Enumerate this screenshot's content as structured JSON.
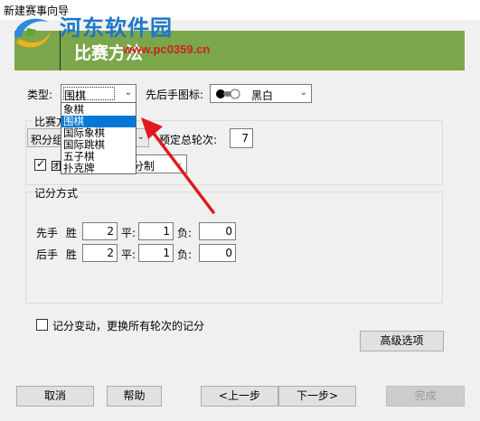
{
  "window": {
    "title": "新建赛事向导"
  },
  "watermark": {
    "name": "河东软件园",
    "url": "www.pc0359.cn"
  },
  "header": {
    "title": "比赛方法"
  },
  "type": {
    "label": "类型:",
    "value": "围棋",
    "options": [
      "象棋",
      "围棋",
      "国际象棋",
      "国际跳棋",
      "五子棋",
      "扑克牌"
    ],
    "selected_index": 1
  },
  "first_move_icon": {
    "label": "先后手图标:",
    "value": "黑白"
  },
  "match_group": {
    "title": "比赛方",
    "method_value": "积分组",
    "rounds_label": "预定总轮次:",
    "rounds_value": "7",
    "team_label": "团",
    "team_checked": true,
    "team_combo_value": "分制"
  },
  "score_group": {
    "title": "记分方式",
    "rows": [
      {
        "label": "先手",
        "win_label": "胜",
        "win": "2",
        "draw_label": "平:",
        "draw": "1",
        "lose_label": "负:",
        "lose": "0"
      },
      {
        "label": "后手",
        "win_label": "胜",
        "win": "2",
        "draw_label": "平:",
        "draw": "1",
        "lose_label": "负:",
        "lose": "0"
      }
    ]
  },
  "score_change": {
    "label": "记分变动，更换所有轮次的记分",
    "checked": false
  },
  "buttons": {
    "advanced": "高级选项",
    "cancel": "取消",
    "help": "帮助",
    "prev": "<上一步",
    "next": "下一步>",
    "finish": "完成"
  },
  "colors": {
    "header_band": "#7ca64a",
    "selection": "#0078d7",
    "arrow": "#e0191c",
    "watermark_name": "#1c78c8",
    "watermark_url": "#cc2222"
  }
}
